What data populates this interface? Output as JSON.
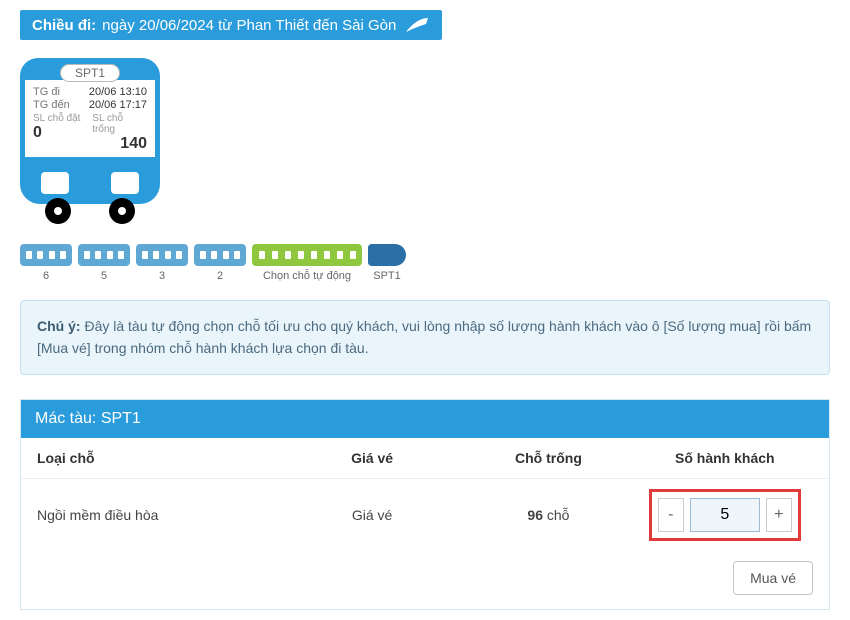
{
  "header": {
    "label": "Chiều đi:",
    "text": "ngày 20/06/2024 từ Phan Thiết đến Sài Gòn"
  },
  "train_card": {
    "code": "SPT1",
    "depart_label": "TG đi",
    "depart_value": "20/06 13:10",
    "arrive_label": "TG đến",
    "arrive_value": "20/06 17:17",
    "booked_label": "SL chỗ đặt",
    "booked_value": "0",
    "empty_label": "SL chỗ trống",
    "empty_value": "140"
  },
  "coaches": [
    {
      "label": "6",
      "type": "normal"
    },
    {
      "label": "5",
      "type": "normal"
    },
    {
      "label": "3",
      "type": "normal"
    },
    {
      "label": "2",
      "type": "normal"
    },
    {
      "label": "Chọn chỗ tự động",
      "type": "auto"
    },
    {
      "label": "SPT1",
      "type": "loco"
    }
  ],
  "notice": {
    "prefix": "Chú ý:",
    "body": " Đây là tàu tự động chọn chỗ tối ưu cho quý khách, vui lòng nhập số lượng hành khách vào ô [Số lượng mua] rồi bấm [Mua vé] trong nhóm chỗ hành khách lựa chọn đi tàu."
  },
  "table": {
    "title_prefix": "Mác tàu: ",
    "title_code": "SPT1",
    "columns": {
      "loai": "Loại chỗ",
      "gia": "Giá vé",
      "cho": "Chỗ trống",
      "qty": "Số hành khách"
    },
    "row": {
      "loai": "Ngồi mềm điều hòa",
      "gia": "Giá vé",
      "cho_number": "96",
      "cho_suffix": " chỗ",
      "qty_value": "5",
      "minus": "-",
      "plus": "+"
    },
    "buy": "Mua vé"
  }
}
